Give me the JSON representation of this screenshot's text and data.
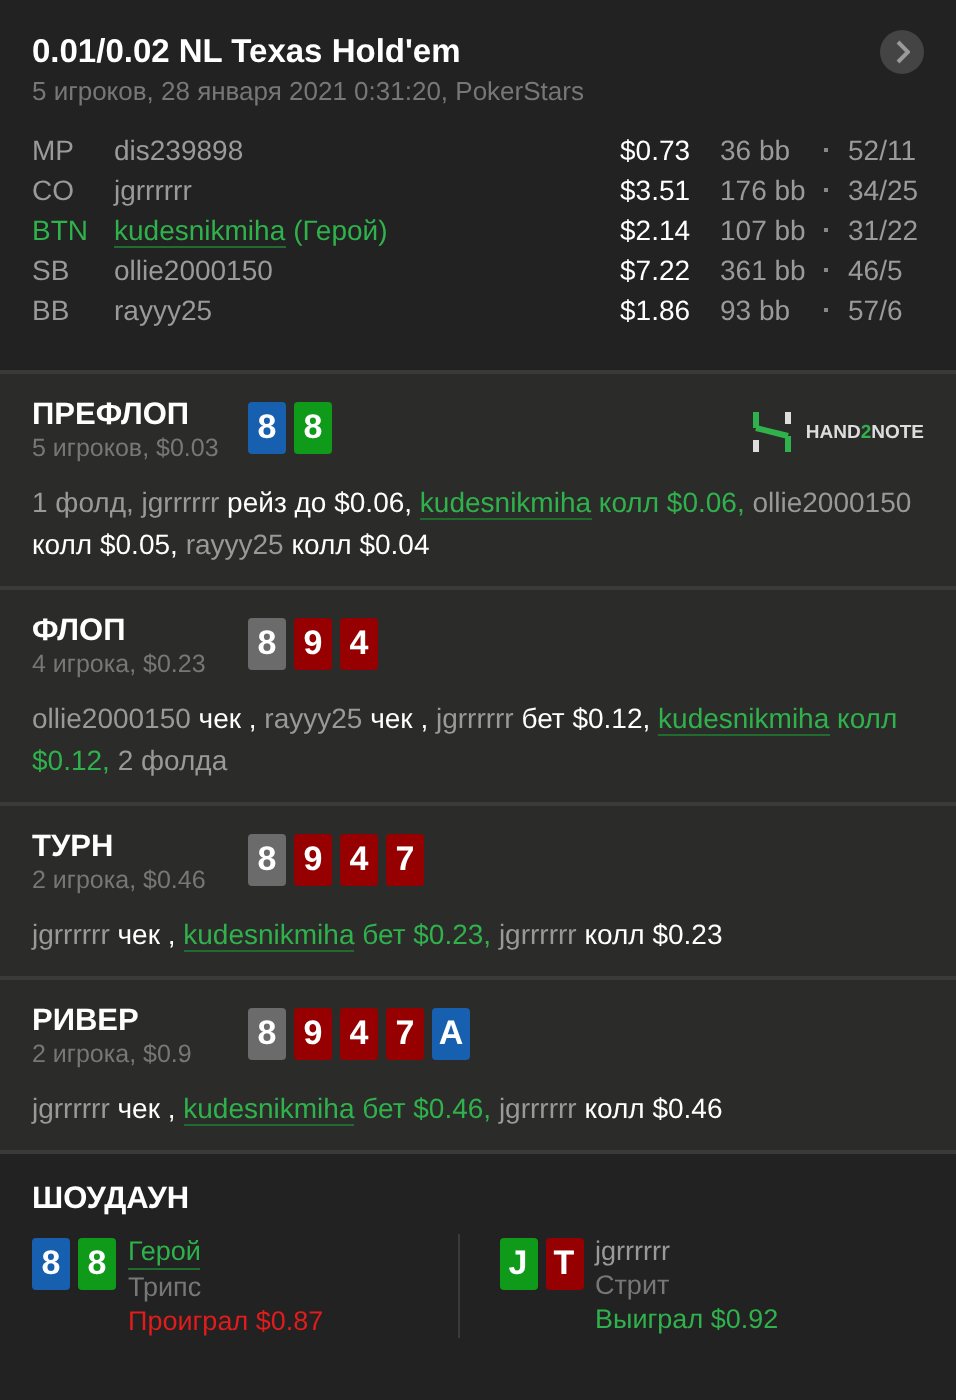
{
  "header": {
    "title": "0.01/0.02 NL Texas Hold'em",
    "subtitle": "5 игроков, 28 января 2021 0:31:20, PokerStars",
    "players": [
      {
        "position": "MP",
        "name": "dis239898",
        "hero": false,
        "stack": "$0.73",
        "bb": "36 bb",
        "stats": "52/11"
      },
      {
        "position": "CO",
        "name": "jgrrrrrr",
        "hero": false,
        "stack": "$3.51",
        "bb": "176 bb",
        "stats": "34/25"
      },
      {
        "position": "BTN",
        "name": "kudesnikmiha",
        "hero": true,
        "hero_tag": "(Герой)",
        "stack": "$2.14",
        "bb": "107 bb",
        "stats": "31/22"
      },
      {
        "position": "SB",
        "name": "ollie2000150",
        "hero": false,
        "stack": "$7.22",
        "bb": "361 bb",
        "stats": "46/5"
      },
      {
        "position": "BB",
        "name": "rayyy25",
        "hero": false,
        "stack": "$1.86",
        "bb": "93 bb",
        "stats": "57/6"
      }
    ]
  },
  "streets": [
    {
      "name": "ПРЕФЛОП",
      "info": "5 игроков, $0.03",
      "logo": {
        "parts": [
          "HAND",
          "2",
          "NOTE"
        ]
      },
      "cards": [
        {
          "rank": "8",
          "color": "#1760b0"
        },
        {
          "rank": "8",
          "color": "#0f9a1a"
        }
      ],
      "actions": [
        {
          "kind": "name",
          "text": "1 фолд, jgrrrrrr"
        },
        {
          "kind": "action",
          "text": " рейз до $0.06, "
        },
        {
          "kind": "hero",
          "text": "kudesnikmiha"
        },
        {
          "kind": "hero_action",
          "text": " колл $0.06, "
        },
        {
          "kind": "name",
          "text": "ollie2000150"
        },
        {
          "kind": "action",
          "text": " колл $0.05, "
        },
        {
          "kind": "name",
          "text": "rayyy25"
        },
        {
          "kind": "action",
          "text": " колл $0.04"
        }
      ]
    },
    {
      "name": "ФЛОП",
      "info": "4 игрока, $0.23",
      "cards": [
        {
          "rank": "8",
          "color": "#6b6b6b"
        },
        {
          "rank": "9",
          "color": "#960000"
        },
        {
          "rank": "4",
          "color": "#960000"
        }
      ],
      "actions": [
        {
          "kind": "name",
          "text": "ollie2000150"
        },
        {
          "kind": "action",
          "text": " чек , "
        },
        {
          "kind": "name",
          "text": "rayyy25"
        },
        {
          "kind": "action",
          "text": " чек , "
        },
        {
          "kind": "name",
          "text": "jgrrrrrr"
        },
        {
          "kind": "action",
          "text": " бет $0.12, "
        },
        {
          "kind": "hero",
          "text": "kudesnikmiha"
        },
        {
          "kind": "hero_action",
          "text": " колл $0.12, "
        },
        {
          "kind": "name",
          "text": "2 фолда"
        }
      ]
    },
    {
      "name": "ТУРН",
      "info": "2 игрока, $0.46",
      "cards": [
        {
          "rank": "8",
          "color": "#6b6b6b"
        },
        {
          "rank": "9",
          "color": "#960000"
        },
        {
          "rank": "4",
          "color": "#960000"
        },
        {
          "rank": "7",
          "color": "#960000"
        }
      ],
      "actions": [
        {
          "kind": "name",
          "text": "jgrrrrrr"
        },
        {
          "kind": "action",
          "text": " чек , "
        },
        {
          "kind": "hero",
          "text": "kudesnikmiha"
        },
        {
          "kind": "hero_action",
          "text": " бет $0.23, "
        },
        {
          "kind": "name",
          "text": "jgrrrrrr"
        },
        {
          "kind": "action",
          "text": " колл $0.23"
        }
      ]
    },
    {
      "name": "РИВЕР",
      "info": "2 игрока, $0.9",
      "cards": [
        {
          "rank": "8",
          "color": "#6b6b6b"
        },
        {
          "rank": "9",
          "color": "#960000"
        },
        {
          "rank": "4",
          "color": "#960000"
        },
        {
          "rank": "7",
          "color": "#960000"
        },
        {
          "rank": "A",
          "color": "#1760b0"
        }
      ],
      "actions": [
        {
          "kind": "name",
          "text": "jgrrrrrr"
        },
        {
          "kind": "action",
          "text": " чек , "
        },
        {
          "kind": "hero",
          "text": "kudesnikmiha"
        },
        {
          "kind": "hero_action",
          "text": " бет $0.46, "
        },
        {
          "kind": "name",
          "text": "jgrrrrrr"
        },
        {
          "kind": "action",
          "text": " колл $0.46"
        }
      ]
    }
  ],
  "showdown": {
    "title": "ШОУДАУН",
    "hands": [
      {
        "name": "Герой",
        "hero": true,
        "hand": "Трипс",
        "result": "Проиграл $0.87",
        "color": "#e01c1c",
        "cards": [
          {
            "rank": "8",
            "color": "#1760b0"
          },
          {
            "rank": "8",
            "color": "#0f9a1a"
          }
        ]
      },
      {
        "name": "jgrrrrrr",
        "hero": false,
        "hand": "Стрит",
        "result": "Выиграл $0.92",
        "color": "#2fb24c",
        "cards": [
          {
            "rank": "J",
            "color": "#0f9a1a"
          },
          {
            "rank": "T",
            "color": "#960000"
          }
        ]
      }
    ]
  }
}
